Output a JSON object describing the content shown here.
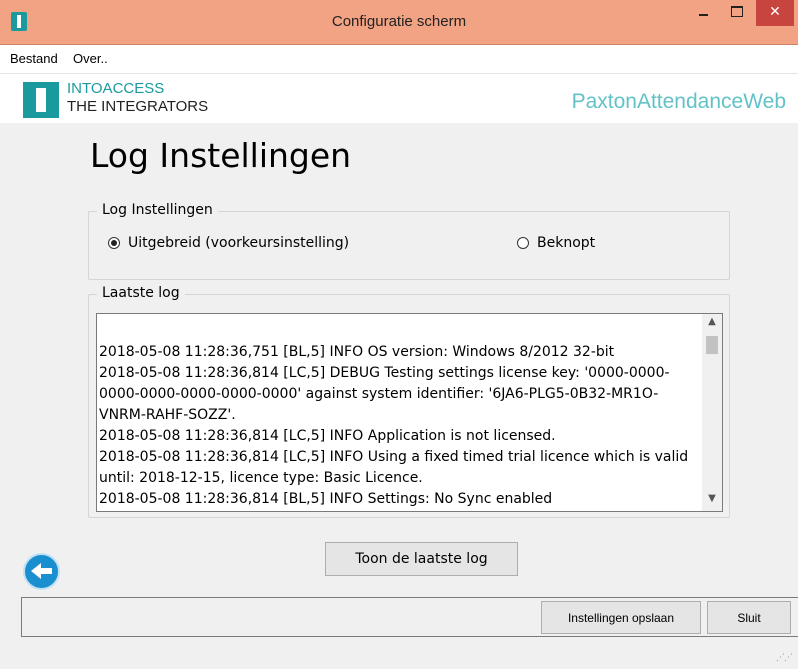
{
  "window": {
    "title": "Configuratie scherm"
  },
  "window_controls": {
    "minimize": "",
    "maximize": "",
    "close": "✕"
  },
  "menu": {
    "items": [
      "Bestand",
      "Over.."
    ]
  },
  "branding": {
    "line1": "INTOACCESS",
    "line2": "THE INTEGRATORS",
    "product": "PaxtonAttendanceWeb",
    "accent": "#1a9a9d"
  },
  "page": {
    "title": "Log Instellingen"
  },
  "log_settings": {
    "legend": "Log Instellingen",
    "options": [
      {
        "label": "Uitgebreid (voorkeursinstelling)",
        "checked": true
      },
      {
        "label": "Beknopt",
        "checked": false
      }
    ]
  },
  "last_log": {
    "legend": "Laatste log",
    "lines": [
      "2018-05-08 11:28:36,751 [BL,5] INFO  OS version: Windows 8/2012 32-bit",
      "2018-05-08 11:28:36,814 [LC,5] DEBUG Testing settings license key: '0000-0000-0000-0000-0000-0000-0000' against system identifier: '6JA6-PLG5-0B32-MR1O-VNRM-RAHF-SOZZ'.",
      "2018-05-08 11:28:36,814 [LC,5] INFO  Application is not licensed.",
      "2018-05-08 11:28:36,814 [LC,5] INFO  Using a fixed timed trial licence which is valid until: 2018-12-15, licence type: Basic Licence.",
      "2018-05-08 11:28:36,814 [BL,5] INFO  Settings: No Sync enabled"
    ]
  },
  "buttons": {
    "show_log": "Toon de laatste log",
    "save": "Instellingen opslaan",
    "close": "Sluit"
  }
}
